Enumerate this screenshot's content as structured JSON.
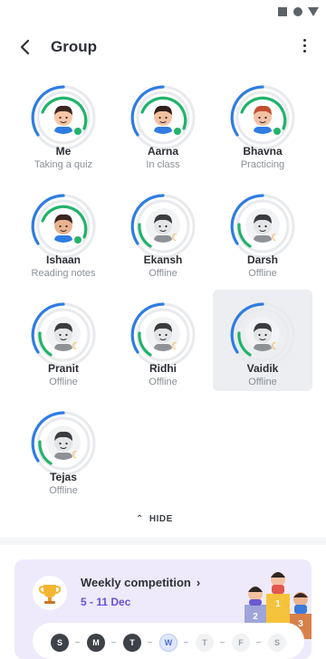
{
  "header": {
    "title": "Group"
  },
  "members": [
    {
      "name": "Me",
      "status": "Taking a quiz",
      "online": true,
      "skin": "#f6c6a6",
      "hair": "#3a2620"
    },
    {
      "name": "Aarna",
      "status": "In class",
      "online": true,
      "skin": "#f3c0a2",
      "hair": "#2f1e1a"
    },
    {
      "name": "Bhavna",
      "status": "Practicing",
      "online": true,
      "skin": "#f3c0a2",
      "hair": "#c24e33"
    },
    {
      "name": "Ishaan",
      "status": "Reading notes",
      "online": true,
      "skin": "#eab38f",
      "hair": "#3a2620"
    },
    {
      "name": "Ekansh",
      "status": "Offline",
      "online": false
    },
    {
      "name": "Darsh",
      "status": "Offline",
      "online": false
    },
    {
      "name": "Pranit",
      "status": "Offline",
      "online": false
    },
    {
      "name": "Ridhi",
      "status": "Offline",
      "online": false
    },
    {
      "name": "Vaidik",
      "status": "Offline",
      "online": false,
      "selected": true
    },
    {
      "name": "Tejas",
      "status": "Offline",
      "online": false
    }
  ],
  "hide_label": "HIDE",
  "competition": {
    "title": "Weekly competition",
    "dates": "5 - 11 Dec",
    "podium_ranks": [
      "1",
      "2",
      "3"
    ],
    "days": [
      {
        "label": "S",
        "state": "done"
      },
      {
        "label": "M",
        "state": "done"
      },
      {
        "label": "T",
        "state": "done"
      },
      {
        "label": "W",
        "state": "today"
      },
      {
        "label": "T",
        "state": "future"
      },
      {
        "label": "F",
        "state": "future"
      },
      {
        "label": "S",
        "state": "future"
      }
    ]
  },
  "colors": {
    "ring_blue": "#2f7ce3",
    "ring_green": "#22b36b",
    "ring_track": "#e8eaed",
    "accent_purple": "#6a4fd8",
    "card_bg": "#eeeafb"
  }
}
